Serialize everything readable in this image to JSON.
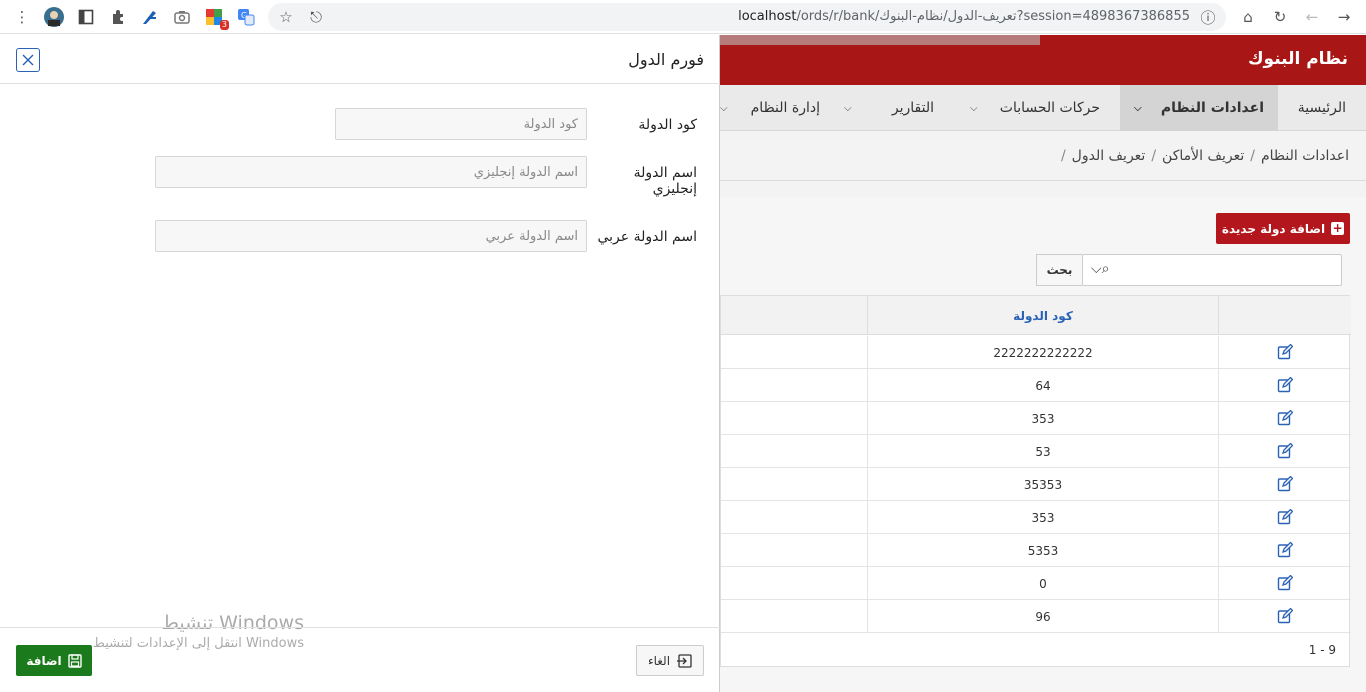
{
  "browser": {
    "url_host": "localhost",
    "url_path": "/ords/r/bank/تعريف-الدول/نظام-البنوك?session=4898367386855",
    "extension_badge": "3",
    "icons": [
      "menu-dots-icon",
      "profile-avatar-icon",
      "sidebar-icon",
      "extensions-icon",
      "pen-extension-icon",
      "camera-icon",
      "colorful-extension-icon",
      "translate-icon",
      "bookmark-star-icon",
      "share-icon",
      "info-icon",
      "home-icon",
      "reload-icon",
      "back-icon",
      "forward-icon"
    ]
  },
  "app": {
    "title": "نظام البنوك",
    "menu": [
      {
        "label": "الرئيسية",
        "dropdown": false,
        "active": false
      },
      {
        "label": "اعدادات النظام",
        "dropdown": true,
        "active": true
      },
      {
        "label": "حركات الحسابات",
        "dropdown": true,
        "active": false
      },
      {
        "label": "التقارير",
        "dropdown": true,
        "active": false
      },
      {
        "label": "إدارة النظام",
        "dropdown": true,
        "active": false
      }
    ],
    "breadcrumb": [
      "اعدادات النظام",
      "تعريف الأماكن",
      "تعريف الدول"
    ],
    "breadcrumb_sep": "/",
    "add_button": "اضافة دولة جديدة",
    "search_button": "بحث",
    "grid": {
      "column": "كود الدولة",
      "rows": [
        "2222222222222",
        "64",
        "353",
        "53",
        "35353",
        "353",
        "5353",
        "0",
        "96"
      ]
    },
    "pagination": "1 - 9",
    "colors": {
      "brand_red": "#a81616",
      "link_blue": "#2a62b6",
      "save_green": "#1b7a1b"
    }
  },
  "dialog": {
    "title": "فورم الدول",
    "fields": [
      {
        "label": "كود الدولة",
        "placeholder": "كود الدولة"
      },
      {
        "label": "اسم الدولة إنجليزي",
        "placeholder": "اسم الدولة إنجليزي"
      },
      {
        "label": "اسم الدولة عربي",
        "placeholder": "اسم الدولة عربي"
      }
    ],
    "cancel_button": "الغاء",
    "save_button": "اضافة"
  },
  "watermark": {
    "line1": "تنشيط Windows",
    "line2": "انتقل إلى الإعدادات لتنشيط Windows"
  }
}
